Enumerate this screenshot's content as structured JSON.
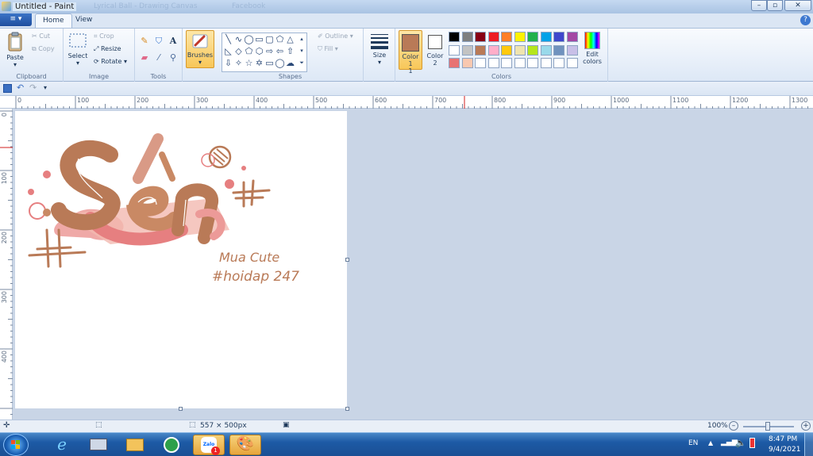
{
  "window": {
    "title": "Untitled - Paint",
    "background_tabs": [
      "Lyrical Ball - Drawing Canvas",
      "Facebook"
    ]
  },
  "menu": {
    "file_label": "≡ ▾",
    "tabs": [
      {
        "label": "Home"
      },
      {
        "label": "View"
      }
    ],
    "active_tab": "Home"
  },
  "ribbon": {
    "clipboard": {
      "label": "Clipboard",
      "paste": "Paste",
      "cut": "Cut",
      "copy": "Copy"
    },
    "image": {
      "label": "Image",
      "select": "Select",
      "crop": "Crop",
      "resize": "Resize",
      "rotate": "Rotate"
    },
    "tools": {
      "label": "Tools"
    },
    "brushes": {
      "label": "Brushes"
    },
    "shapes": {
      "label": "Shapes",
      "outline": "Outline",
      "fill": "Fill"
    },
    "size": {
      "label": "Size"
    },
    "colors": {
      "label": "Colors",
      "color1_label": "Color 1",
      "color1_num": "1",
      "color2_label": "Color",
      "color2_num": "2",
      "edit_colors": "Edit colors",
      "color1": "#b97a57",
      "color2": "#ffffff",
      "palette": [
        "#000000",
        "#7f7f7f",
        "#880015",
        "#ed1c24",
        "#ff7f27",
        "#fff200",
        "#22b14c",
        "#00a2e8",
        "#3f48cc",
        "#a349a4",
        "#ffffff",
        "#c3c3c3",
        "#b97a57",
        "#ffaec9",
        "#ffc90e",
        "#efe4b0",
        "#b5e61d",
        "#99d9ea",
        "#7092be",
        "#c8bfe7",
        "#e87373",
        "#f9c8b0",
        "#ffffff",
        "#ffffff",
        "#ffffff",
        "#ffffff",
        "#ffffff",
        "#ffffff",
        "#ffffff",
        "#ffffff"
      ]
    }
  },
  "ruler": {
    "h_ticks": [
      "0",
      "100",
      "200",
      "300",
      "400",
      "500",
      "600",
      "700",
      "800",
      "900",
      "1000",
      "1100",
      "1200",
      "1300"
    ],
    "v_ticks": [
      "0",
      "100",
      "200",
      "300",
      "400"
    ]
  },
  "canvas": {
    "artwork": {
      "word": "Sến",
      "signature": "Mua Cute",
      "tag": "#hoidap 247"
    }
  },
  "status": {
    "canvas_size": "557 × 500px",
    "zoom": "100%"
  },
  "taskbar": {
    "zalo_badge": "1",
    "zalo_label": "Zalo",
    "lang": "EN",
    "time": "8:47 PM",
    "date": "9/4/2021"
  }
}
